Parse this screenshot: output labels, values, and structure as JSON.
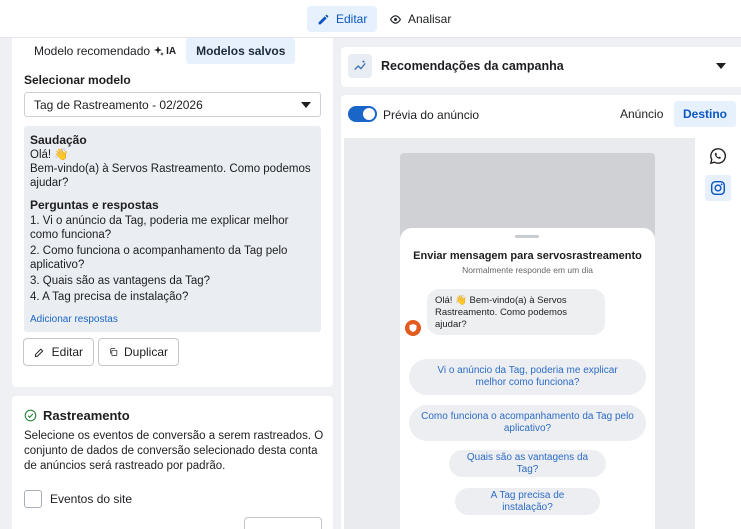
{
  "topbar": {
    "edit_label": "Editar",
    "analyze_label": "Analisar"
  },
  "template_card": {
    "tabs": [
      {
        "label": "Modelo recomendado",
        "badge": "IA"
      },
      {
        "label": "Modelos salvos"
      }
    ],
    "select_label": "Selecionar modelo",
    "selected_template": "Tag de Rastreamento - 02/2026",
    "greeting_heading": "Saudação",
    "greeting_line1": "Olá! 👋",
    "greeting_line2": "Bem-vindo(a) à Servos Rastreamento. Como podemos ajudar?",
    "faq_heading": "Perguntas e respostas",
    "faq": [
      "1. Vi o anúncio da Tag, poderia me explicar melhor como funciona?",
      "2. Como funciona o acompanhamento da Tag pelo aplicativo?",
      "3. Quais são as vantagens da Tag?",
      "4. A Tag precisa de instalação?"
    ],
    "add_answers": "Adicionar respostas",
    "edit_button": "Editar",
    "duplicate_button": "Duplicar"
  },
  "tracking_card": {
    "title": "Rastreamento",
    "description": "Selecione os eventos de conversão a serem rastreados. O conjunto de dados de conversão selecionado desta conta de anúncios será rastreado por padrão.",
    "checkbox_label": "Eventos do site"
  },
  "recommendations": {
    "title": "Recomendações da campanha"
  },
  "preview": {
    "toggle_label": "Prévia do anúncio",
    "seg_ad": "Anúncio",
    "seg_destination": "Destino",
    "sheet_title": "Enviar mensagem para servosrastreamento",
    "sheet_subtitle": "Normalmente responde em um dia",
    "message": "Olá! 👋 Bem-vindo(a) à Servos Rastreamento. Como podemos ajudar?",
    "quick_replies": [
      "Vi o anúncio da Tag, poderia me explicar melhor como funciona?",
      "Como funciona o acompanhamento da Tag pelo aplicativo?",
      "Quais são as vantagens da Tag?",
      "A Tag precisa de instalação?"
    ]
  },
  "colors": {
    "accent": "#1a66c8",
    "active_bg": "#e7f0fd",
    "page_bg": "#eef0f4"
  }
}
